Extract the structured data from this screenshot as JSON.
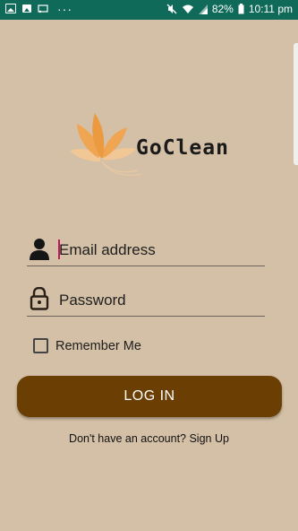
{
  "status_bar": {
    "battery": "82%",
    "time": "10:11 pm",
    "icons": [
      "gallery-icon",
      "photo-icon",
      "cast-icon",
      "more-dots-icon",
      "mute-icon",
      "wifi-icon",
      "signal-icon",
      "battery-icon"
    ]
  },
  "brand": {
    "name": "GoClean"
  },
  "login": {
    "email_placeholder": "Email address",
    "password_placeholder": "Password",
    "remember_label": "Remember Me",
    "remember_checked": false,
    "button_label": "LOG IN",
    "signup_text": "Don't have an account? Sign Up"
  },
  "colors": {
    "background": "#d4c0a6",
    "status_bar": "#0f6a5a",
    "button": "#6b3e03",
    "logo_petal": "#f0a552"
  }
}
